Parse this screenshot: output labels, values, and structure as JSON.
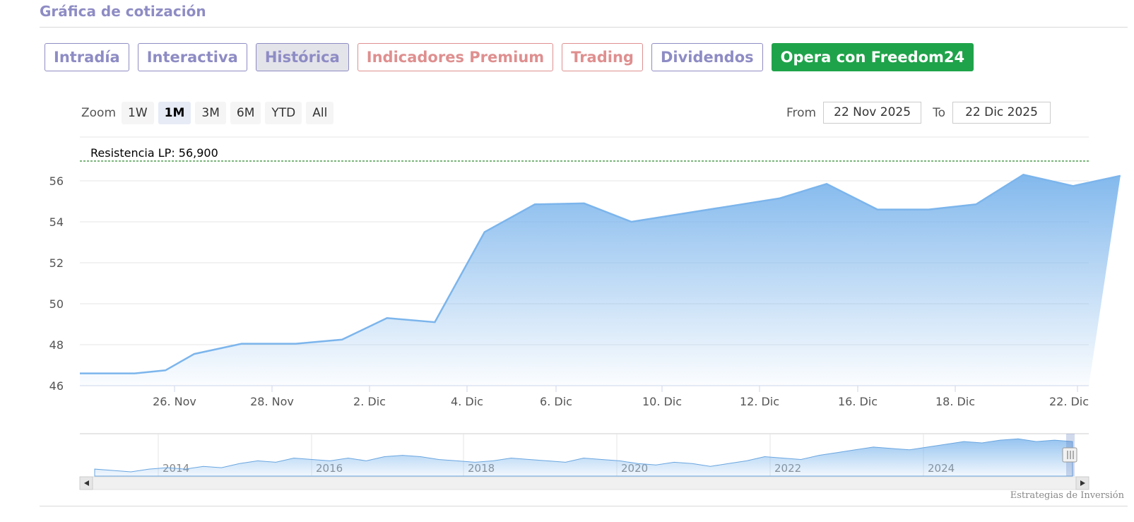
{
  "header": {
    "title": "Gráfica de cotización"
  },
  "tabs": [
    {
      "label": "Intradía",
      "kind": "normal"
    },
    {
      "label": "Interactiva",
      "kind": "normal"
    },
    {
      "label": "Histórica",
      "kind": "active"
    },
    {
      "label": "Indicadores Premium",
      "kind": "premium"
    },
    {
      "label": "Trading",
      "kind": "premium"
    },
    {
      "label": "Dividendos",
      "kind": "normal"
    },
    {
      "label": "Opera con Freedom24",
      "kind": "freedom"
    }
  ],
  "zoom": {
    "label": "Zoom",
    "options": [
      "1W",
      "1M",
      "3M",
      "6M",
      "YTD",
      "All"
    ],
    "selected": "1M"
  },
  "range": {
    "from_label": "From",
    "from_value": "22 Nov 2025",
    "to_label": "To",
    "to_value": "22 Dic 2025"
  },
  "credit": "Estrategias de Inversión",
  "colors": {
    "accent": "#8e8cc4",
    "premium": "#df8f8f",
    "freedom": "#1fa34a",
    "series": "#7cb5ec",
    "resistance": "#2e8b2e"
  },
  "chart_data": {
    "type": "area",
    "x_start": "2025-11-24",
    "ylim": [
      46,
      56
    ],
    "yticks": [
      46,
      48,
      50,
      52,
      54,
      56
    ],
    "x_ticks": [
      {
        "label": "26. Nov",
        "day": 2
      },
      {
        "label": "28. Nov",
        "day": 4
      },
      {
        "label": "2. Dic",
        "day": 8
      },
      {
        "label": "4. Dic",
        "day": 10
      },
      {
        "label": "6. Dic",
        "day": 12
      },
      {
        "label": "10. Dic",
        "day": 16
      },
      {
        "label": "12. Dic",
        "day": 18
      },
      {
        "label": "16. Dic",
        "day": 22
      },
      {
        "label": "18. Dic",
        "day": 24
      },
      {
        "label": "22. Dic",
        "day": 28
      }
    ],
    "points": [
      [
        0.53,
        46.6
      ],
      [
        1.16,
        46.75
      ],
      [
        1.75,
        47.55
      ],
      [
        2.72,
        48.05
      ],
      [
        3.83,
        48.05
      ],
      [
        4.78,
        48.25
      ],
      [
        5.7,
        49.3
      ],
      [
        6.68,
        49.1
      ],
      [
        7.7,
        53.5
      ],
      [
        8.73,
        54.85
      ],
      [
        9.74,
        54.9
      ],
      [
        10.71,
        54.0
      ],
      [
        13.75,
        55.15
      ],
      [
        14.71,
        55.85
      ],
      [
        15.75,
        54.6
      ],
      [
        16.8,
        54.6
      ],
      [
        17.77,
        54.85
      ],
      [
        18.74,
        56.3
      ],
      [
        19.76,
        55.75
      ],
      [
        20.73,
        56.25
      ]
    ],
    "resistance": {
      "label": "Resistencia LP: 56,900",
      "value": 56.9
    },
    "navigator": {
      "year_labels": [
        "2014",
        "2016",
        "2018",
        "2020",
        "2022",
        "2024"
      ],
      "values": [
        46,
        45.5,
        45,
        46,
        46.5,
        46,
        47,
        46.5,
        48,
        49,
        48.5,
        50,
        49.5,
        49,
        50,
        49,
        50.5,
        51,
        50.5,
        49.5,
        49,
        48.5,
        49,
        50,
        49.5,
        49,
        48.5,
        50,
        49.5,
        49,
        48,
        47.5,
        48.5,
        48,
        47,
        48,
        49,
        50.5,
        50,
        49.5,
        51,
        52,
        53,
        54,
        53.5,
        53,
        54,
        55,
        56,
        55.5,
        56.5,
        57,
        56,
        56.5,
        56
      ]
    }
  }
}
